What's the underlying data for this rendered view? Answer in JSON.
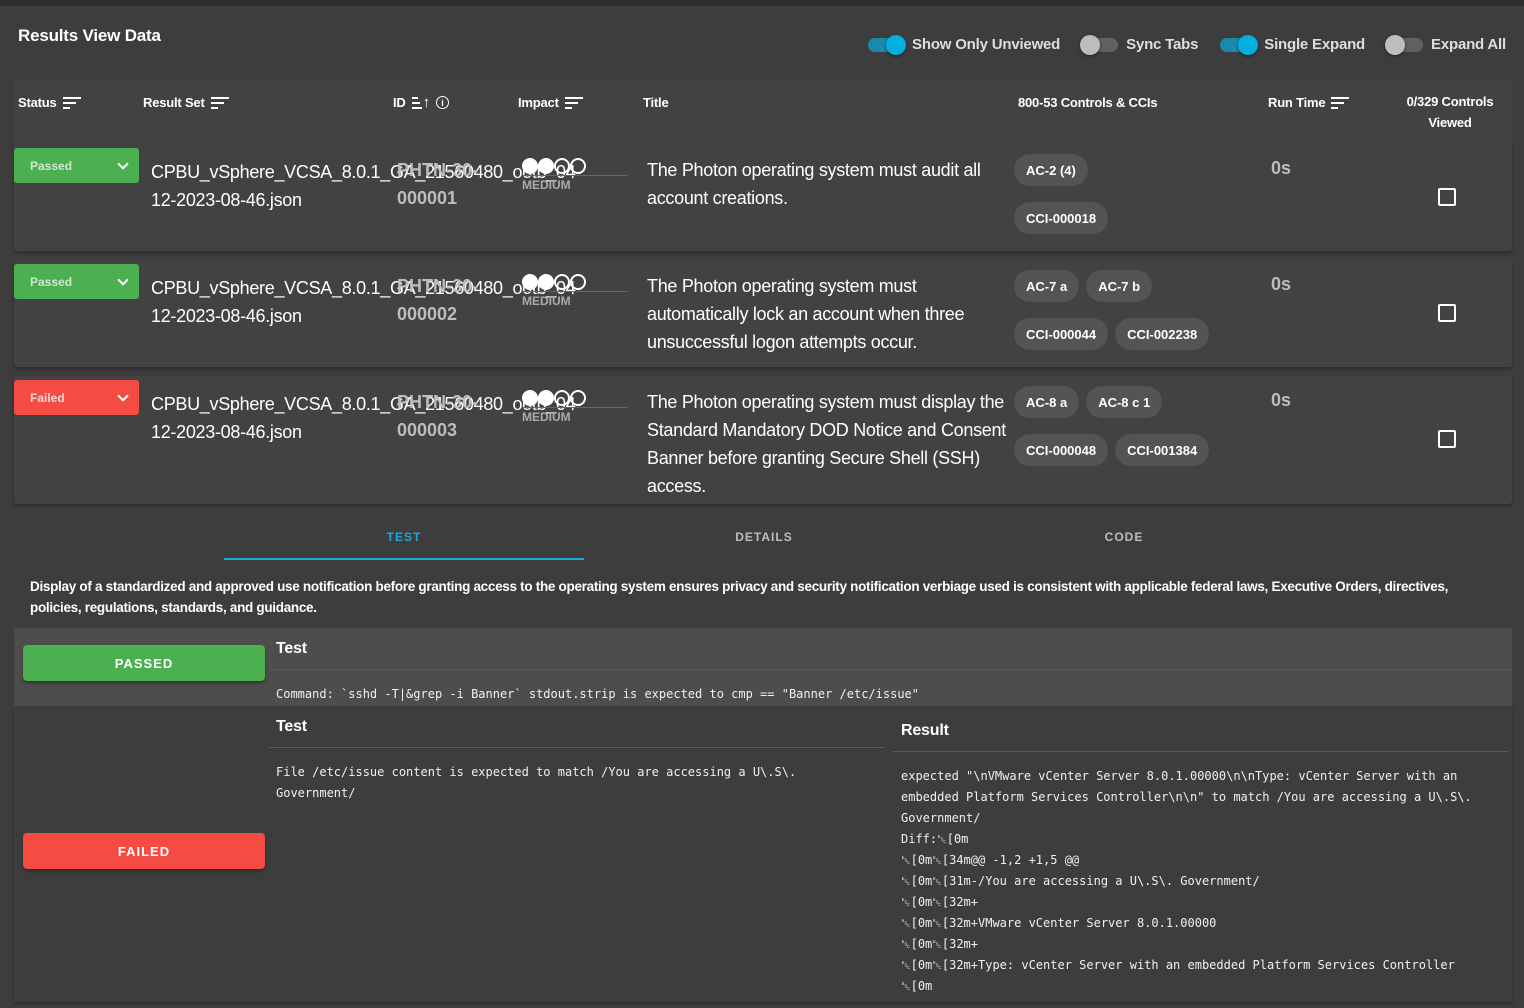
{
  "header": {
    "title": "Results View Data"
  },
  "toggles": [
    {
      "label": "Show Only Unviewed",
      "on": true
    },
    {
      "label": "Sync Tabs",
      "on": false
    },
    {
      "label": "Single Expand",
      "on": true
    },
    {
      "label": "Expand All",
      "on": false
    }
  ],
  "table": {
    "headers": {
      "status": "Status",
      "result_set": "Result Set",
      "id": "ID",
      "impact": "Impact",
      "title": "Title",
      "controls": "800-53 Controls & CCIs",
      "run_time": "Run Time",
      "viewed_line1": "0/329 Controls",
      "viewed_line2": "Viewed"
    },
    "rows": [
      {
        "status": "Passed",
        "result_set": "CPBU_vSphere_VCSA_8.0.1_GA_21560480_ootb_04-12-2023-08-46.json",
        "id": "PHTN-30-000001",
        "impact_level": 2,
        "impact_max": 4,
        "impact": "MEDIUM",
        "title": "The Photon operating system must audit all account creations.",
        "controls": [
          "AC-2 (4)"
        ],
        "ccis": [
          "CCI-000018"
        ],
        "run_time": "0s",
        "viewed": false
      },
      {
        "status": "Passed",
        "result_set": "CPBU_vSphere_VCSA_8.0.1_GA_21560480_ootb_04-12-2023-08-46.json",
        "id": "PHTN-30-000002",
        "impact_level": 2,
        "impact_max": 4,
        "impact": "MEDIUM",
        "title": "The Photon operating system must automatically lock an account when three unsuccessful logon attempts occur.",
        "controls": [
          "AC-7 a",
          "AC-7 b"
        ],
        "ccis": [
          "CCI-000044",
          "CCI-002238"
        ],
        "run_time": "0s",
        "viewed": false
      },
      {
        "status": "Failed",
        "result_set": "CPBU_vSphere_VCSA_8.0.1_GA_21560480_ootb_04-12-2023-08-46.json",
        "id": "PHTN-30-000003",
        "impact_level": 2,
        "impact_max": 4,
        "impact": "MEDIUM",
        "title": "The Photon operating system must display the Standard Mandatory DOD Notice and Consent Banner before granting Secure Shell (SSH) access.",
        "controls": [
          "AC-8 a",
          "AC-8 c 1"
        ],
        "ccis": [
          "CCI-000048",
          "CCI-001384"
        ],
        "run_time": "0s",
        "viewed": false
      }
    ]
  },
  "detail": {
    "tabs": [
      {
        "label": "TEST",
        "active": true
      },
      {
        "label": "DETAILS",
        "active": false
      },
      {
        "label": "CODE",
        "active": false
      }
    ],
    "description": "Display of a standardized and approved use notification before granting access to the operating system ensures privacy and security notification verbiage used is consistent with applicable federal laws, Executive Orders, directives, policies, regulations, standards, and guidance.",
    "results": [
      {
        "status": "PASSED",
        "test_heading": "Test",
        "test": "Command: `sshd -T|&grep -i Banner` stdout.strip is expected to cmp == \"Banner /etc/issue\""
      },
      {
        "status": "FAILED",
        "test_heading": "Test",
        "test": "File /etc/issue content is expected to match /You are accessing a U\\.S\\. Government/",
        "result_heading": "Result",
        "result": "expected \"\\nVMware vCenter Server 8.0.1.00000\\n\\nType: vCenter Server with an embedded Platform Services Controller\\n\\n\" to match /You are accessing a U\\.S\\. Government/\nDiff:\u001b[0m\n\u001b[0m\u001b[34m@@ -1,2 +1,5 @@\n\u001b[0m\u001b[31m-/You are accessing a U\\.S\\. Government/\n\u001b[0m\u001b[32m+\n\u001b[0m\u001b[32m+VMware vCenter Server 8.0.1.00000\n\u001b[0m\u001b[32m+\n\u001b[0m\u001b[32m+Type: vCenter Server with an embedded Platform Services Controller\n\u001b[0m"
      }
    ]
  },
  "colors": {
    "accent": "#1ca8d8",
    "passed": "#4caf50",
    "failed": "#f44b42",
    "toggle_on": "#03b0e0"
  }
}
